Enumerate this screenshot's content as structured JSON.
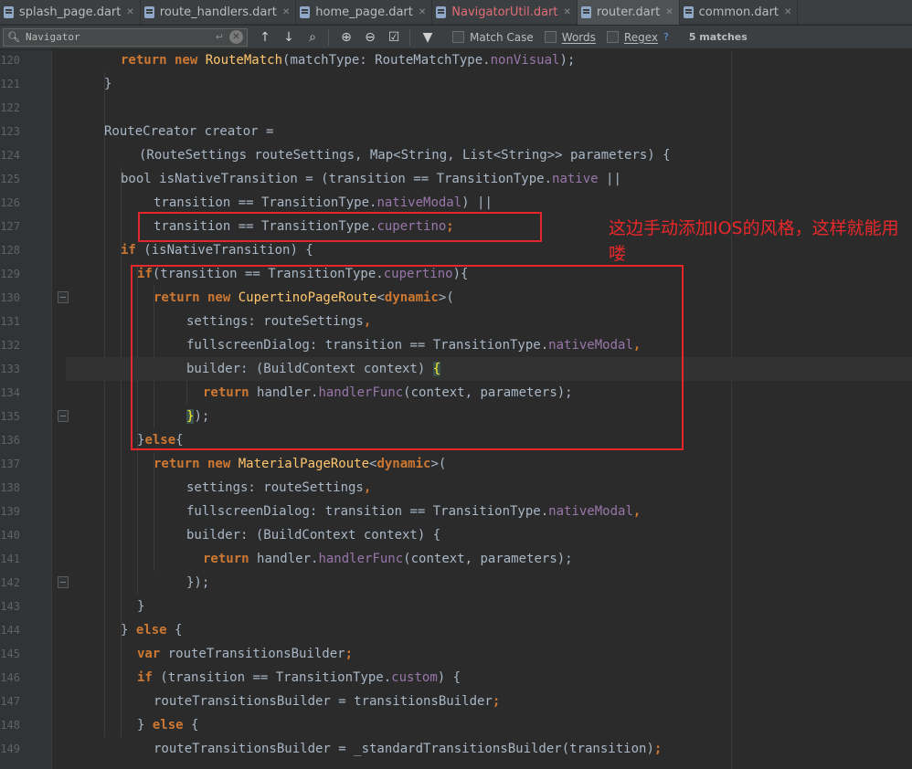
{
  "tabs": [
    {
      "label": "splash_page.dart",
      "active": false,
      "modified": false
    },
    {
      "label": "route_handlers.dart",
      "active": false,
      "modified": false
    },
    {
      "label": "home_page.dart",
      "active": false,
      "modified": false
    },
    {
      "label": "NavigatorUtil.dart",
      "active": false,
      "modified": true
    },
    {
      "label": "router.dart",
      "active": true,
      "modified": false
    },
    {
      "label": "common.dart",
      "active": false,
      "modified": false
    }
  ],
  "find": {
    "query": "Navigator",
    "options": {
      "match_case": "Match Case",
      "words": "Words",
      "regex": "Regex"
    },
    "help": "?",
    "matches": "5 matches"
  },
  "icons": {
    "tab_close": "close-icon",
    "file": "dart-file-icon",
    "search": "search-icon",
    "enter": "enter-icon",
    "clear": "clear-icon",
    "prev": "arrow-up-icon",
    "next": "arrow-down-icon",
    "find_all": "find-all-icon",
    "add_selection": "add-selection-icon",
    "remove_selection": "remove-selection-icon",
    "select_all": "select-all-occurrences-icon",
    "filter": "filter-icon"
  },
  "line_numbers": [
    "120",
    "121",
    "122",
    "123",
    "124",
    "125",
    "126",
    "127",
    "128",
    "129",
    "130",
    "131",
    "132",
    "133",
    "134",
    "135",
    "136",
    "137",
    "138",
    "139",
    "140",
    "141",
    "142",
    "143",
    "144",
    "145",
    "146",
    "147",
    "148",
    "149"
  ],
  "code": [
    {
      "indent": 60,
      "t": [
        [
          "kw",
          "return new "
        ],
        [
          "fn",
          "RouteMatch"
        ],
        [
          "pr",
          "(matchType: RouteMatchType."
        ],
        [
          "fld",
          "nonVisual"
        ],
        [
          "pr",
          ");"
        ]
      ]
    },
    {
      "indent": 42,
      "t": [
        [
          "pr",
          "}"
        ]
      ]
    },
    {
      "indent": 0,
      "t": []
    },
    {
      "indent": 42,
      "t": [
        [
          "pr",
          "RouteCreator creator ="
        ]
      ]
    },
    {
      "indent": 80,
      "t": [
        [
          "pr",
          "(RouteSettings routeSettings, Map<String, List<String>> parameters) {"
        ]
      ]
    },
    {
      "indent": 60,
      "t": [
        [
          "pr",
          "bool isNativeTransition = (transition == TransitionType."
        ],
        [
          "fld",
          "native"
        ],
        [
          "pr",
          " ||"
        ]
      ]
    },
    {
      "indent": 96,
      "t": [
        [
          "pr",
          "transition == TransitionType."
        ],
        [
          "fld",
          "nativeModal"
        ],
        [
          "pr",
          ") ||"
        ]
      ]
    },
    {
      "indent": 96,
      "t": [
        [
          "pr",
          "transition == TransitionType."
        ],
        [
          "fld",
          "cupertino"
        ],
        [
          "kw",
          ";"
        ]
      ]
    },
    {
      "indent": 60,
      "t": [
        [
          "kw",
          "if "
        ],
        [
          "pr",
          "(isNativeTransition) {"
        ]
      ]
    },
    {
      "indent": 78,
      "t": [
        [
          "kw",
          "if"
        ],
        [
          "pr",
          "(transition == TransitionType."
        ],
        [
          "fld",
          "cupertino"
        ],
        [
          "pr",
          "){"
        ]
      ]
    },
    {
      "indent": 96,
      "t": [
        [
          "kw",
          "return new "
        ],
        [
          "fn",
          "CupertinoPageRoute"
        ],
        [
          "pr",
          "<"
        ],
        [
          "kw",
          "dynamic"
        ],
        [
          "pr",
          ">("
        ]
      ]
    },
    {
      "indent": 132,
      "t": [
        [
          "pr",
          "settings: routeSettings"
        ],
        [
          "kw",
          ","
        ]
      ]
    },
    {
      "indent": 132,
      "t": [
        [
          "pr",
          "fullscreenDialog: transition == TransitionType."
        ],
        [
          "fld",
          "nativeModal"
        ],
        [
          "kw",
          ","
        ]
      ]
    },
    {
      "indent": 132,
      "t": [
        [
          "pr",
          "builder: (BuildContext context) "
        ],
        [
          "braceh",
          "{"
        ]
      ]
    },
    {
      "indent": 150,
      "t": [
        [
          "kw",
          "return "
        ],
        [
          "pr",
          "handler."
        ],
        [
          "fld",
          "handlerFunc"
        ],
        [
          "pr",
          "(context, parameters);"
        ]
      ]
    },
    {
      "indent": 132,
      "t": [
        [
          "braceh",
          "}"
        ],
        [
          "pr",
          ");"
        ]
      ]
    },
    {
      "indent": 78,
      "t": [
        [
          "pr",
          "}"
        ],
        [
          "kw",
          "else"
        ],
        [
          "pr",
          "{"
        ]
      ]
    },
    {
      "indent": 96,
      "t": [
        [
          "kw",
          "return new "
        ],
        [
          "fn",
          "MaterialPageRoute"
        ],
        [
          "pr",
          "<"
        ],
        [
          "kw",
          "dynamic"
        ],
        [
          "pr",
          ">("
        ]
      ]
    },
    {
      "indent": 132,
      "t": [
        [
          "pr",
          "settings: routeSettings"
        ],
        [
          "kw",
          ","
        ]
      ]
    },
    {
      "indent": 132,
      "t": [
        [
          "pr",
          "fullscreenDialog: transition == TransitionType."
        ],
        [
          "fld",
          "nativeModal"
        ],
        [
          "kw",
          ","
        ]
      ]
    },
    {
      "indent": 132,
      "t": [
        [
          "pr",
          "builder: (BuildContext context) {"
        ]
      ]
    },
    {
      "indent": 150,
      "t": [
        [
          "kw",
          "return "
        ],
        [
          "pr",
          "handler."
        ],
        [
          "fld",
          "handlerFunc"
        ],
        [
          "pr",
          "(context, parameters);"
        ]
      ]
    },
    {
      "indent": 132,
      "t": [
        [
          "pr",
          "});"
        ]
      ]
    },
    {
      "indent": 78,
      "t": [
        [
          "pr",
          "}"
        ]
      ]
    },
    {
      "indent": 60,
      "t": [
        [
          "pr",
          "} "
        ],
        [
          "kw",
          "else "
        ],
        [
          "pr",
          "{"
        ]
      ]
    },
    {
      "indent": 78,
      "t": [
        [
          "kw",
          "var "
        ],
        [
          "pr",
          "routeTransitionsBuilder"
        ],
        [
          "kw",
          ";"
        ]
      ]
    },
    {
      "indent": 78,
      "t": [
        [
          "kw",
          "if "
        ],
        [
          "pr",
          "(transition == TransitionType."
        ],
        [
          "fld",
          "custom"
        ],
        [
          "pr",
          ") {"
        ]
      ]
    },
    {
      "indent": 96,
      "t": [
        [
          "pr",
          "routeTransitionsBuilder = transitionsBuilder"
        ],
        [
          "kw",
          ";"
        ]
      ]
    },
    {
      "indent": 78,
      "t": [
        [
          "pr",
          "} "
        ],
        [
          "kw",
          "else "
        ],
        [
          "pr",
          "{"
        ]
      ]
    },
    {
      "indent": 96,
      "t": [
        [
          "pr",
          "routeTransitionsBuilder = _standardTransitionsBuilder(transition)"
        ],
        [
          "kw",
          ";"
        ]
      ]
    }
  ],
  "annotation": "这边手动添加IOS的风格，这样就能用喽",
  "colors": {
    "background": "#2b2b2b",
    "keyword": "#cc7832",
    "field": "#9876aa",
    "function": "#ffc66d",
    "plain": "#a9b7c6",
    "annotation_red": "#e8272a"
  }
}
